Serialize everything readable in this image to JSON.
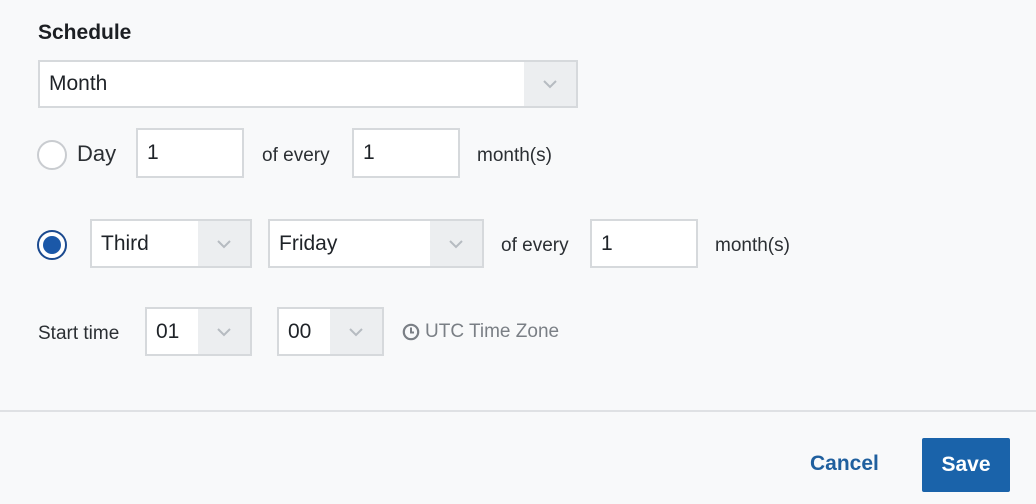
{
  "schedule": {
    "heading": "Schedule",
    "frequency": "Month"
  },
  "day_option": {
    "label": "Day",
    "day_value": "1",
    "of_every_label": "of every",
    "interval_value": "1",
    "unit_label": "month(s)",
    "selected": false
  },
  "weekday_option": {
    "ordinal": "Third",
    "weekday": "Friday",
    "of_every_label": "of every",
    "interval_value": "1",
    "unit_label": "month(s)",
    "selected": true
  },
  "start_time": {
    "label": "Start time",
    "hour": "01",
    "minute": "00",
    "timezone": "UTC Time Zone"
  },
  "footer": {
    "cancel_label": "Cancel",
    "save_label": "Save"
  },
  "colors": {
    "accent": "#1a63aa",
    "link": "#1f5f9e"
  },
  "icons": {
    "dropdown": "chevron-down-icon",
    "clock": "clock-icon"
  }
}
